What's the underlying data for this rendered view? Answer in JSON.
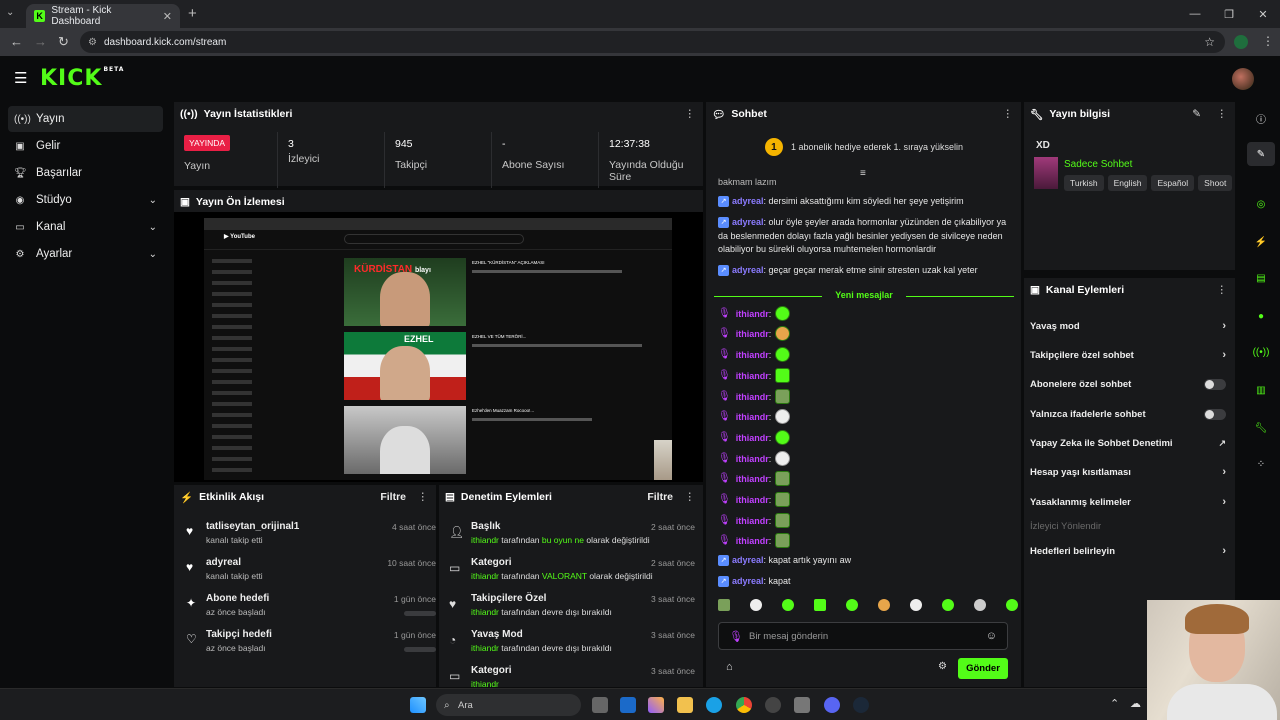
{
  "browser": {
    "tab_title": "Stream - Kick Dashboard",
    "url": "dashboard.kick.com/stream"
  },
  "header": {
    "logo": "KICK",
    "logo_badge": "BETA"
  },
  "sidebar": {
    "items": [
      {
        "label": "Yayın",
        "icon": "broadcast-icon"
      },
      {
        "label": "Gelir",
        "icon": "income-icon"
      },
      {
        "label": "Başarılar",
        "icon": "trophy-icon"
      },
      {
        "label": "Stüdyo",
        "icon": "studio-icon"
      },
      {
        "label": "Kanal",
        "icon": "channel-icon"
      },
      {
        "label": "Ayarlar",
        "icon": "gear-icon"
      }
    ]
  },
  "stats": {
    "title": "Yayın İstatistikleri",
    "live_badge": "YAYINDA",
    "live_label": "Yayın",
    "viewers_value": "3",
    "viewers_label": "İzleyici",
    "followers_value": "945",
    "followers_label": "Takipçi",
    "subs_value": "-",
    "subs_label": "Abone Sayısı",
    "duration_value": "12:37:38",
    "duration_label": "Yayında Olduğu Süre"
  },
  "preview": {
    "title": "Yayın Ön İzlemesi",
    "thumb1_title": "KÜRDİSTAN",
    "thumb1_title_suffix": "blayı",
    "thumb2_title": "EZHEL",
    "video1_title": "EZHEL \"KÜRDİSTAN\" AÇIKLAMASI",
    "video2_title": "EZHEL VE TÜM TERÖRİ...",
    "video3_title": "Ezhel'den Muazzam Rocooo!..."
  },
  "activity": {
    "title": "Etkinlik Akışı",
    "filter": "Filtre",
    "items": [
      {
        "title": "tatliseytan_orijinal1",
        "sub": "kanalı takip etti",
        "time": "4 saat önce",
        "icon": "heart-icon"
      },
      {
        "title": "adyreal",
        "sub": "kanalı takip etti",
        "time": "10 saat önce",
        "icon": "heart-icon"
      },
      {
        "title": "Abone hedefi",
        "sub": "az önce başladı",
        "time": "1 gün önce",
        "icon": "sparkle-icon"
      },
      {
        "title": "Takipçi hedefi",
        "sub": "az önce başladı",
        "time": "1 gün önce",
        "icon": "heart-outline-icon"
      }
    ]
  },
  "moderation": {
    "title": "Denetim Eylemleri",
    "filter": "Filtre",
    "items": [
      {
        "title": "Başlık",
        "user": "ithiandr",
        "mid": " tarafından ",
        "hl": "bu oyun ne",
        "end": " olarak değiştirildi",
        "time": "2 saat önce",
        "icon": "user-edit-icon"
      },
      {
        "title": "Kategori",
        "user": "ithiandr",
        "mid": " tarafından ",
        "hl": "VALORANT",
        "end": " olarak değiştirildi",
        "time": "2 saat önce",
        "icon": "category-icon"
      },
      {
        "title": "Takipçilere Özel",
        "user": "ithiandr",
        "mid": " tarafından devre dışı bırakıldı",
        "hl": "",
        "end": "",
        "time": "3 saat önce",
        "icon": "user-heart-icon"
      },
      {
        "title": "Yavaş Mod",
        "user": "ithiandr",
        "mid": " tarafından devre dışı bırakıldı",
        "hl": "",
        "end": "",
        "time": "3 saat önce",
        "icon": "slow-mode-icon"
      },
      {
        "title": "Kategori",
        "user": "ithiandr",
        "mid": "",
        "hl": "",
        "end": "",
        "time": "3 saat önce",
        "icon": "category-icon"
      }
    ]
  },
  "chat": {
    "title": "Sohbet",
    "gift_count": "1",
    "gift_text": "1 abonelik hediye ederek 1. sıraya yükselin",
    "cut_line": "bakmam lazım",
    "messages": [
      {
        "user": "adyreal",
        "text": ": dersimi aksattığımı kim söyledi her şeye yetişirim"
      },
      {
        "user": "adyreal",
        "text": ": olur öyle şeyler arada hormonlar yüzünden de çıkabiliyor ya da beslenmeden dolayı fazla yağlı besinler yediysen de sivilceye neden olabiliyor bu sürekli oluyorsa muhtemelen hormonlardir"
      },
      {
        "user": "adyreal",
        "text": ": geçar geçar merak etme sinir stresten uzak kal yeter"
      }
    ],
    "new_messages": "Yeni mesajlar",
    "ith_user": "ithiandr",
    "later": [
      {
        "user": "adyreal",
        "text": ": kapat artık yayını aw"
      },
      {
        "user": "adyreal",
        "text": ": kapat"
      }
    ],
    "input_placeholder": "Bir mesaj gönderin",
    "send": "Gönder"
  },
  "stream_info": {
    "title": "Yayın bilgisi",
    "stream_title": "XD",
    "category": "Sadece Sohbet",
    "tags": [
      "Turkish",
      "English",
      "Español",
      "Shoot"
    ]
  },
  "channel_actions": {
    "title": "Kanal Eylemleri",
    "items": [
      {
        "label": "Yavaş mod",
        "ctrl": "arrow"
      },
      {
        "label": "Takipçilere özel sohbet",
        "ctrl": "arrow"
      },
      {
        "label": "Abonelere özel sohbet",
        "ctrl": "toggle"
      },
      {
        "label": "Yalnızca ifadelerle sohbet",
        "ctrl": "toggle"
      },
      {
        "label": "Yapay Zeka ile Sohbet Denetimi",
        "ctrl": "ext"
      },
      {
        "label": "Hesap yaşı kısıtlaması",
        "ctrl": "arrow"
      },
      {
        "label": "Yasaklanmış kelimeler",
        "ctrl": "arrow"
      },
      {
        "label": "İzleyici Yönlendir",
        "ctrl": "none"
      },
      {
        "label": "Hedefleri belirleyin",
        "ctrl": "arrow"
      }
    ]
  },
  "taskbar": {
    "search": "Ara"
  },
  "colors": {
    "accent": "#53fc18",
    "live": "#e91f45",
    "username": "#8b7bff",
    "mod_user": "#c040ff"
  }
}
